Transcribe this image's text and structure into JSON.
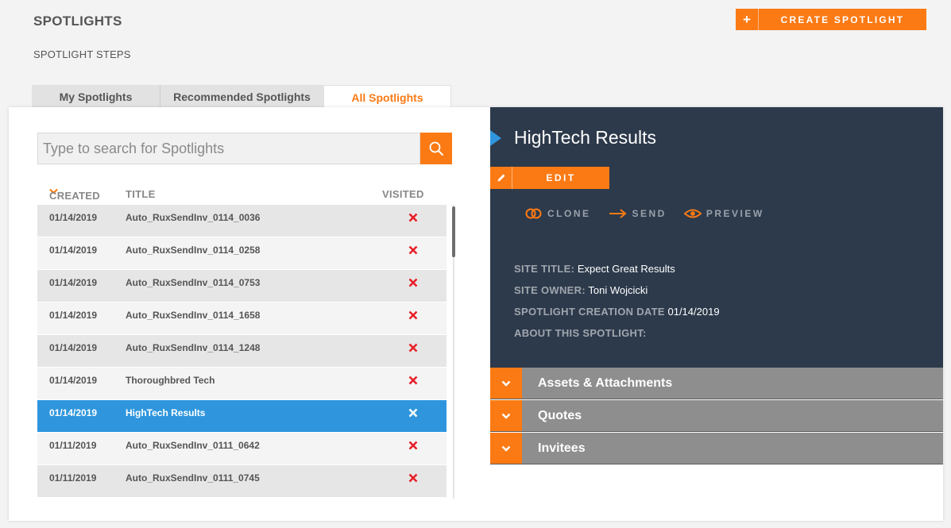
{
  "header": {
    "title": "SPOTLIGHTS",
    "subtitle": "SPOTLIGHT STEPS",
    "create_plus": "+",
    "create_label": "CREATE SPOTLIGHT"
  },
  "tabs": [
    {
      "label": "My Spotlights",
      "active": false
    },
    {
      "label": "Recommended Spotlights",
      "active": false
    },
    {
      "label": "All Spotlights",
      "active": true
    }
  ],
  "search": {
    "placeholder": "Type to search for Spotlights",
    "value": ""
  },
  "table": {
    "columns": {
      "created": "CREATED",
      "title": "TITLE",
      "visited": "VISITED"
    },
    "sort": {
      "column": "created",
      "direction": "descending"
    },
    "rows": [
      {
        "created": "01/14/2019",
        "title": "Auto_RuxSendInv_0114_0036",
        "visited": false,
        "selected": false
      },
      {
        "created": "01/14/2019",
        "title": "Auto_RuxSendInv_0114_0258",
        "visited": false,
        "selected": false
      },
      {
        "created": "01/14/2019",
        "title": "Auto_RuxSendInv_0114_0753",
        "visited": false,
        "selected": false
      },
      {
        "created": "01/14/2019",
        "title": "Auto_RuxSendInv_0114_1658",
        "visited": false,
        "selected": false
      },
      {
        "created": "01/14/2019",
        "title": "Auto_RuxSendInv_0114_1248",
        "visited": false,
        "selected": false
      },
      {
        "created": "01/14/2019",
        "title": "Thoroughbred Tech",
        "visited": false,
        "selected": false
      },
      {
        "created": "01/14/2019",
        "title": "HighTech Results",
        "visited": false,
        "selected": true
      },
      {
        "created": "01/11/2019",
        "title": "Auto_RuxSendInv_0111_0642",
        "visited": false,
        "selected": false
      },
      {
        "created": "01/11/2019",
        "title": "Auto_RuxSendInv_0111_0745",
        "visited": false,
        "selected": false
      }
    ]
  },
  "detail": {
    "title": "HighTech Results",
    "edit_label": "EDIT",
    "actions": {
      "clone": "CLONE",
      "send": "SEND",
      "preview": "PREVIEW"
    },
    "meta": {
      "site_title_label": "SITE TITLE:",
      "site_title": "Expect Great Results",
      "site_owner_label": "SITE OWNER:",
      "site_owner": "Toni Wojcicki",
      "creation_date_label": "SPOTLIGHT CREATION DATE",
      "creation_date": "01/14/2019",
      "about_label": "ABOUT THIS SPOTLIGHT:"
    },
    "sections": [
      "Assets & Attachments",
      "Quotes",
      "Invitees"
    ]
  },
  "colors": {
    "accent": "#fb7a14",
    "selected_row": "#2f96dd",
    "detail_bg": "#2d3a4b",
    "not_visited_icon": "#e8202a"
  },
  "icons": {
    "search": "search-icon",
    "sort": "chevron-down-icon",
    "not_visited": "close-icon",
    "edit": "pencil-icon",
    "clone": "clone-icon",
    "send": "arrow-right-icon",
    "preview": "eye-icon",
    "section": "chevron-down-icon"
  }
}
